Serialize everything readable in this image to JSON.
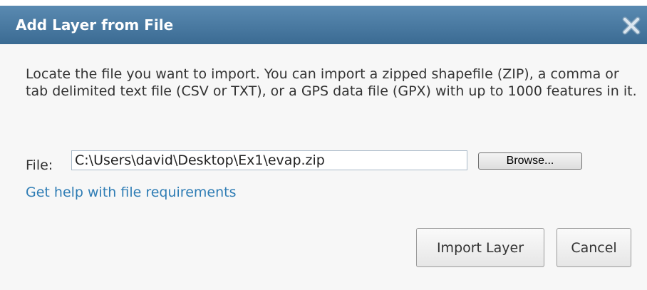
{
  "dialog": {
    "title": "Add Layer from File",
    "close_icon": "close-icon",
    "description": "Locate the file you want to import. You can import a zipped shapefile (ZIP), a comma or tab delimited text file (CSV or TXT), or a GPS data file (GPX) with up to 1000 features in it.",
    "file": {
      "label": "File:",
      "value": "C:\\Users\\david\\Desktop\\Ex1\\evap.zip",
      "browse_label": "Browse..."
    },
    "help_link": "Get help with file requirements",
    "buttons": {
      "import_label": "Import Layer",
      "cancel_label": "Cancel"
    }
  },
  "colors": {
    "titlebar": "#3e6e96",
    "title_text": "#ffffff",
    "link": "#2f7db5",
    "body_background": "#f7f7f7"
  }
}
